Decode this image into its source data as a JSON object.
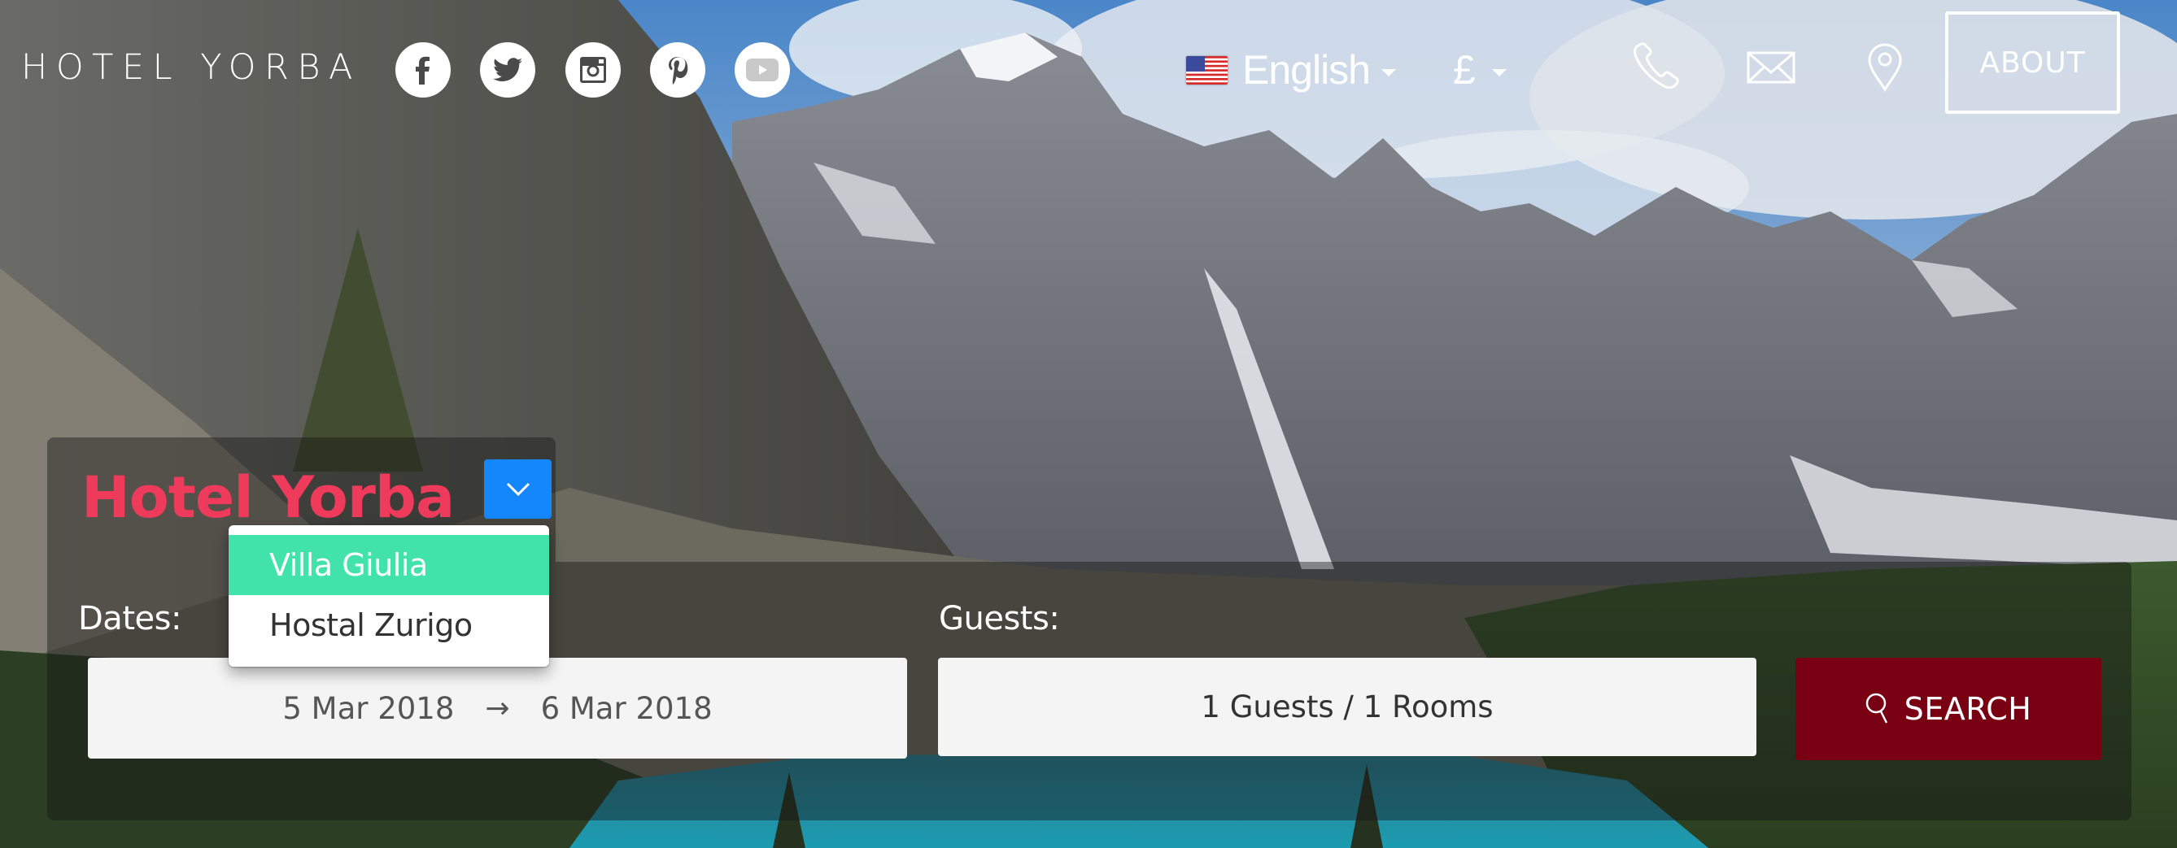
{
  "header": {
    "brand": "HOTEL YORBA",
    "social": [
      {
        "name": "facebook",
        "icon": "facebook-icon"
      },
      {
        "name": "twitter",
        "icon": "twitter-icon"
      },
      {
        "name": "instagram",
        "icon": "instagram-icon"
      },
      {
        "name": "pinterest",
        "icon": "pinterest-icon"
      },
      {
        "name": "youtube",
        "icon": "youtube-icon"
      }
    ],
    "language": {
      "label": "English",
      "flag": "us-flag-icon"
    },
    "currency": {
      "label": "£"
    },
    "contact_icons": [
      "phone-icon",
      "mail-icon",
      "location-pin-icon"
    ],
    "about_label": "ABOUT"
  },
  "booking": {
    "hotel_name": "Hotel Yorba",
    "hotel_dropdown": {
      "options": [
        "Villa Giulia",
        "Hostal Zurigo"
      ],
      "highlighted": "Villa Giulia"
    },
    "dates_label": "Dates:",
    "check_in": "5 Mar 2018",
    "arrow": "→",
    "check_out": "6 Mar 2018",
    "guests_label": "Guests:",
    "guests_value": "1 Guests / 1 Rooms",
    "search_label": "SEARCH"
  },
  "colors": {
    "logo": "#ee3a5b",
    "toggle_button": "#1487fd",
    "dropdown_highlight": "#41e3ab",
    "search_button": "#780012"
  }
}
